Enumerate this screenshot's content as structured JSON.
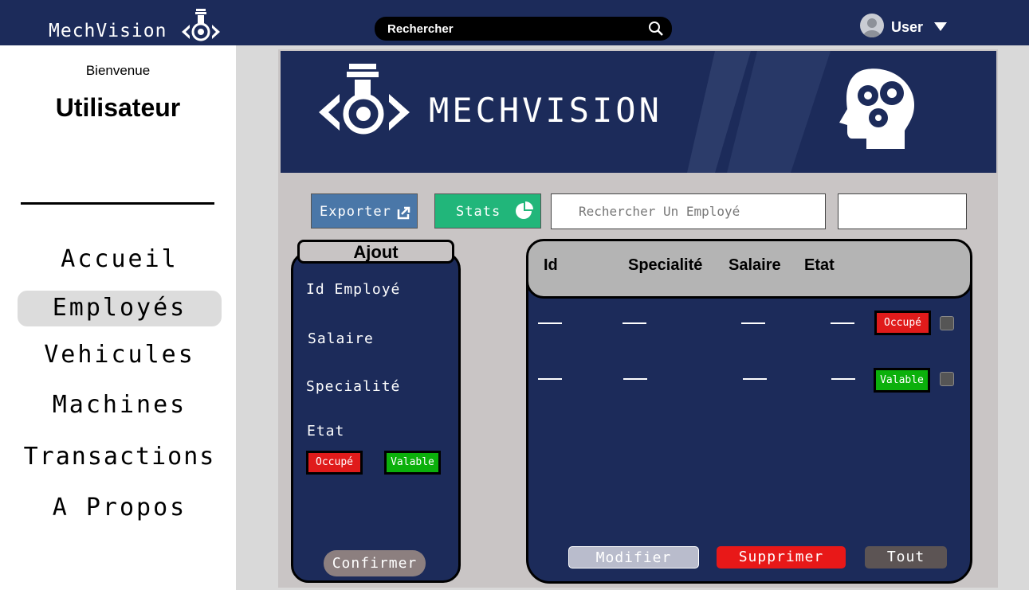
{
  "app": {
    "brand": "MechVision"
  },
  "search": {
    "placeholder": "Rechercher"
  },
  "user": {
    "name": "User"
  },
  "sidebar": {
    "welcome": "Bienvenue",
    "username": "Utilisateur",
    "items": [
      {
        "label": "Accueil",
        "active": false
      },
      {
        "label": "Employés",
        "active": true
      },
      {
        "label": "Vehicules",
        "active": false
      },
      {
        "label": "Machines",
        "active": false
      },
      {
        "label": "Transactions",
        "active": false
      },
      {
        "label": "A Propos",
        "active": false
      }
    ]
  },
  "banner": {
    "title": "MECHVISION"
  },
  "toolbar": {
    "export_label": "Exporter",
    "stats_label": "Stats",
    "employee_search_placeholder": "Rechercher Un Employé",
    "extra_field_value": ""
  },
  "form": {
    "title": "Ajout",
    "fields": [
      "Id Employé",
      "Salaire",
      "Specialité",
      "Etat"
    ],
    "state_options": [
      "Occupé",
      "Valable"
    ],
    "confirm_label": "Confirmer"
  },
  "table": {
    "columns": [
      "Id",
      "Specialité",
      "Salaire",
      "Etat"
    ],
    "rows": [
      {
        "status": "Occupé",
        "checked": false
      },
      {
        "status": "Valable",
        "checked": false
      }
    ],
    "actions": {
      "modify": "Modifier",
      "delete": "Supprimer",
      "all": "Tout"
    }
  },
  "colors": {
    "navy": "#1c2b5a",
    "occupied": "#e01b1b",
    "available": "#0bb00b",
    "export": "#4a77a8",
    "stats": "#21b67a",
    "delete": "#e81818"
  }
}
